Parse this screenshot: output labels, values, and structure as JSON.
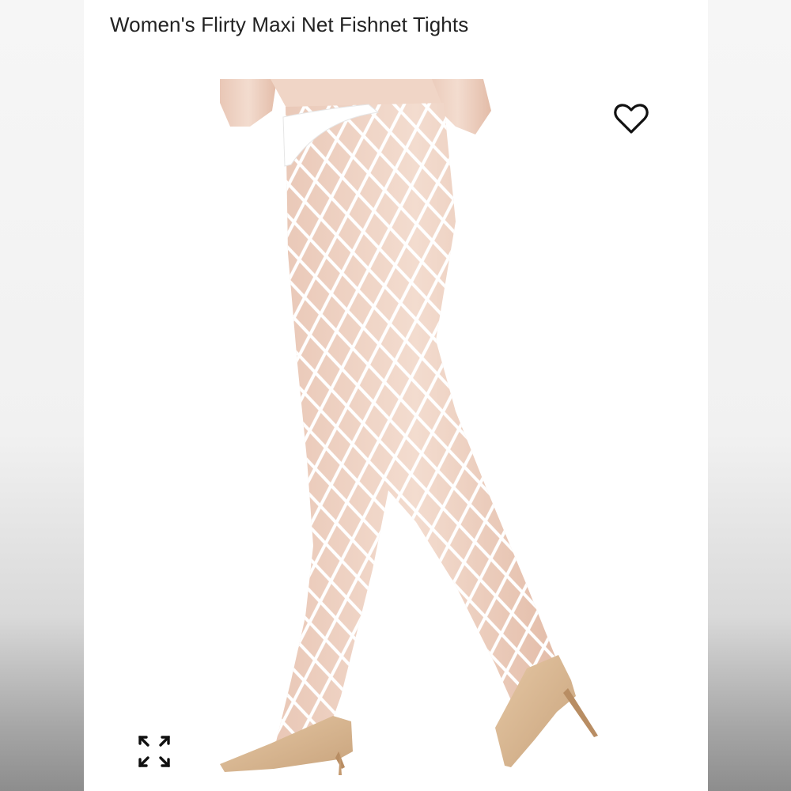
{
  "product": {
    "title": "Women's Flirty Maxi Net Fishnet Tights"
  },
  "actions": {
    "wishlist_icon": "heart-outline-icon",
    "expand_icon": "expand-arrows-icon"
  },
  "photo": {
    "subject": "fishnet-tights-model",
    "tights_color": "#ffffff",
    "shoe_color": "#d9b894",
    "skin_color": "#f1d6c8"
  }
}
